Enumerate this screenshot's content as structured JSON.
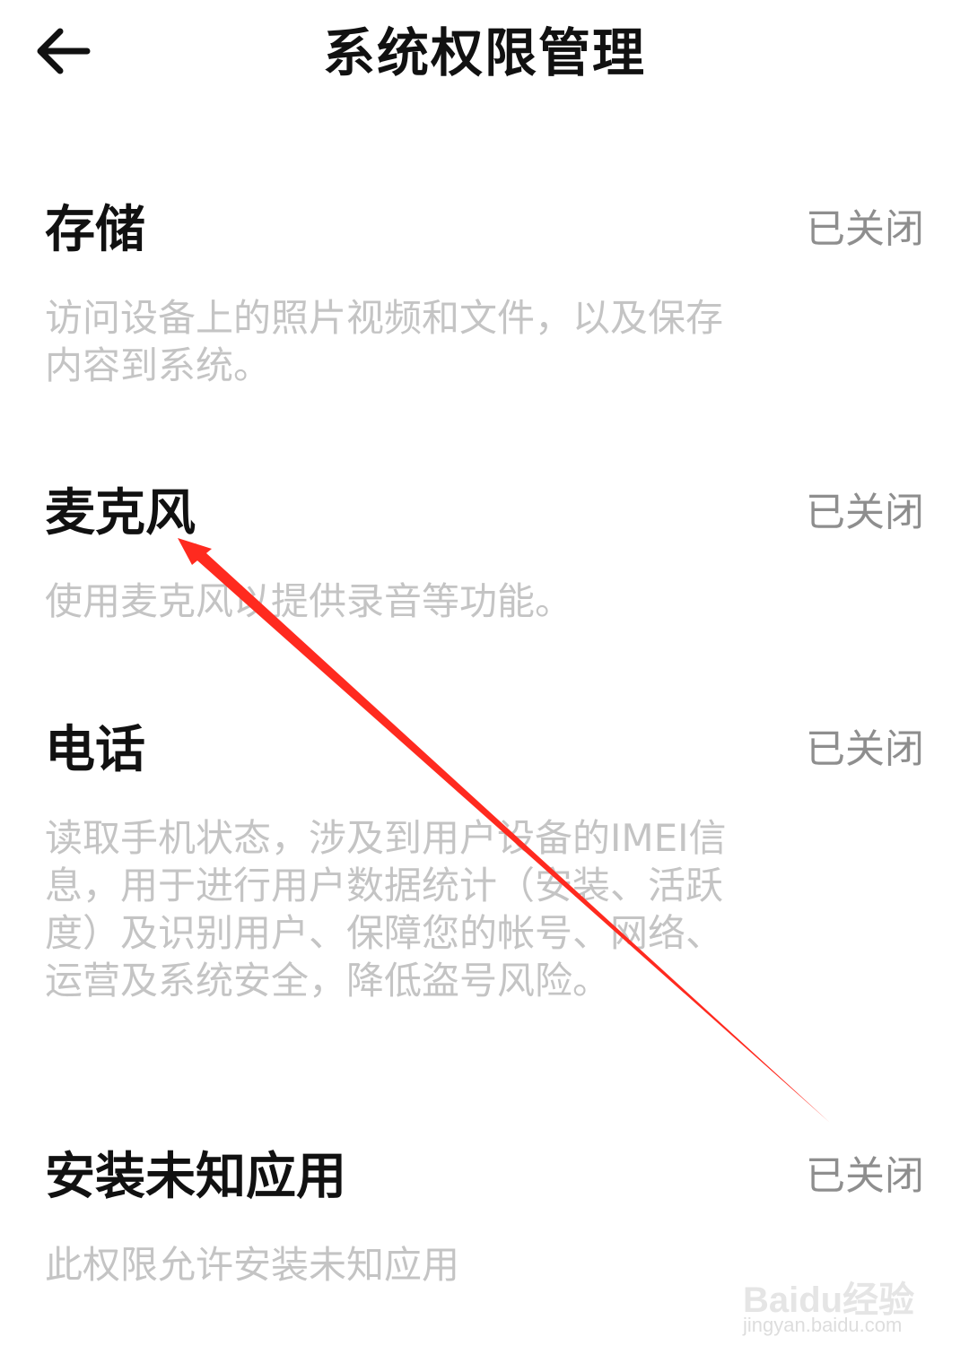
{
  "header": {
    "back_icon": "arrow-left-icon",
    "title": "系统权限管理"
  },
  "permissions": [
    {
      "name": "存储",
      "status": "已关闭",
      "description": "访问设备上的照片视频和文件，以及保存内容到系统。"
    },
    {
      "name": "麦克风",
      "status": "已关闭",
      "description": "使用麦克风以提供录音等功能。"
    },
    {
      "name": "电话",
      "status": "已关闭",
      "description": "读取手机状态，涉及到用户设备的IMEI信息，用于进行用户数据统计（安装、活跃度）及识别用户、保障您的帐号、网络、运营及系统安全，降低盗号风险。"
    },
    {
      "name": "安装未知应用",
      "status": "已关闭",
      "description": "此权限允许安装未知应用"
    }
  ],
  "annotation": {
    "arrow_color": "#ff2a1f"
  },
  "watermark": {
    "brand": "Baidu经验",
    "url": "jingyan.baidu.com"
  }
}
